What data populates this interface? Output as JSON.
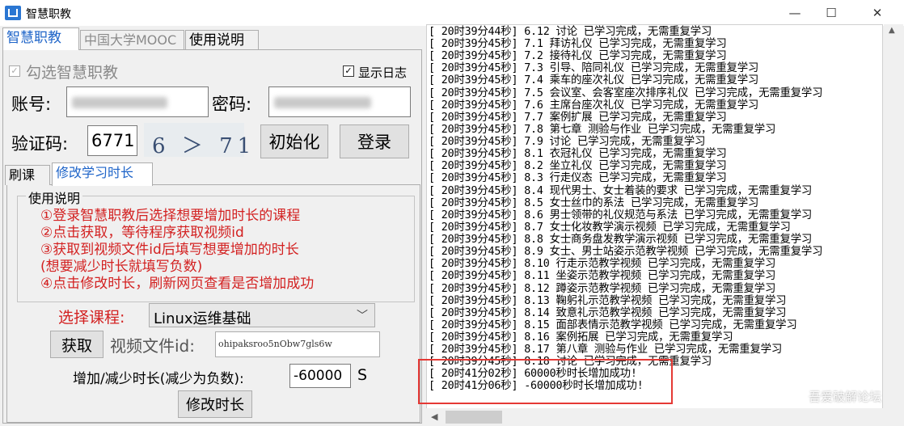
{
  "window": {
    "title": "智慧职教",
    "minimize": "—",
    "maximize": "☐",
    "close": "✕"
  },
  "tabs": [
    "智慧职教",
    "中国大学MOOC",
    "使用说明"
  ],
  "account": {
    "select_zhihui_label": "勾选智慧职教",
    "show_log_label": "显示日志",
    "username_label": "账号:",
    "password_label": "密码:",
    "captcha_label": "验证码:",
    "captcha_value": "6771",
    "captcha_image_text": "6 ＞ 71",
    "init_button": "初始化",
    "login_button": "登录"
  },
  "subtabs": [
    "刷课",
    "修改学习时长"
  ],
  "instructions": {
    "legend": "使用说明",
    "lines": [
      "①登录智慧职教后选择想要增加时长的课程",
      "②点击获取，等待程序获取视频id",
      "③获取到视频文件id后填写想要增加的时长",
      "(想要减少时长就填写负数)",
      "④点击修改时长，刷新网页查看是否增加成功"
    ]
  },
  "course": {
    "label": "选择课程:",
    "selected": "Linux运维基础",
    "fetch_button": "获取",
    "video_id_label": "视频文件id:",
    "video_id_value": "ohipaksroo5nObw7gls6w",
    "duration_label": "增加/减少时长(减少为负数):",
    "duration_value": "-60000",
    "duration_unit": "S",
    "modify_button": "修改时长"
  },
  "log": [
    "[ 20时39分44秒] 6.12 讨论 已学习完成，无需重复学习",
    "[ 20时39分45秒] 7.1 拜访礼仪 已学习完成，无需重复学习",
    "[ 20时39分45秒] 7.2 接待礼仪 已学习完成，无需重复学习",
    "[ 20时39分45秒] 7.3 引导、陪同礼仪 已学习完成，无需重复学习",
    "[ 20时39分45秒] 7.4 乘车的座次礼仪 已学习完成，无需重复学习",
    "[ 20时39分45秒] 7.5 会议室、会客室座次排序礼仪 已学习完成，无需重复学习",
    "[ 20时39分45秒] 7.6 主席台座次礼仪 已学习完成，无需重复学习",
    "[ 20时39分45秒] 7.7 案例扩展 已学习完成，无需重复学习",
    "[ 20时39分45秒] 7.8 第七章 测验与作业 已学习完成，无需重复学习",
    "[ 20时39分45秒] 7.9 讨论 已学习完成，无需重复学习",
    "[ 20时39分45秒] 8.1 衣冠礼仪 已学习完成，无需重复学习",
    "[ 20时39分45秒] 8.2 坐立礼仪 已学习完成，无需重复学习",
    "[ 20时39分45秒] 8.3 行走仪态 已学习完成，无需重复学习",
    "[ 20时39分45秒] 8.4 现代男士、女士着装的要求 已学习完成，无需重复学习",
    "[ 20时39分45秒] 8.5 女士丝巾的系法 已学习完成，无需重复学习",
    "[ 20时39分45秒] 8.6 男士领带的礼仪规范与系法 已学习完成，无需重复学习",
    "[ 20时39分45秒] 8.7 女士化妆教学演示视频 已学习完成，无需重复学习",
    "[ 20时39分45秒] 8.8 女士商务盘发教学演示视频 已学习完成，无需重复学习",
    "[ 20时39分45秒] 8.9 女士、男士站姿示范教学视频 已学习完成，无需重复学习",
    "[ 20时39分45秒] 8.10 行走示范教学视频 已学习完成，无需重复学习",
    "[ 20时39分45秒] 8.11 坐姿示范教学视频 已学习完成，无需重复学习",
    "[ 20时39分45秒] 8.12 蹲姿示范教学视频 已学习完成，无需重复学习",
    "[ 20时39分45秒] 8.13 鞠躬礼示范教学视频 已学习完成，无需重复学习",
    "[ 20时39分45秒] 8.14 致意礼示范教学视频 已学习完成，无需重复学习",
    "[ 20时39分45秒] 8.15 面部表情示范教学视频 已学习完成，无需重复学习",
    "[ 20时39分45秒] 8.16 案例拓展 已学习完成，无需重复学习",
    "[ 20时39分45秒] 8.17 第八章 测验与作业 已学习完成，无需重复学习",
    "[ 20时39分45秒] 8.18 讨论 已学习完成，无需重复学习",
    "[ 20时41分02秒] 60000秒时长增加成功!",
    "[ 20时41分06秒] -60000秒时长增加成功!"
  ],
  "scroll": {
    "left_arrow": "◀",
    "up_arrow": "▲"
  },
  "watermark": "吾爱破解论坛"
}
